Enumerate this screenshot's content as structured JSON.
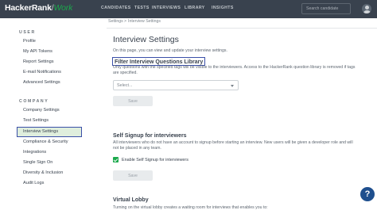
{
  "header": {
    "brand": "HackerRank",
    "brand_suffix": "Work",
    "nav": [
      "CANDIDATES",
      "TESTS",
      "INTERVIEWS",
      "LIBRARY",
      "INSIGHTS"
    ],
    "search_placeholder": "Search candidate"
  },
  "sidebar": {
    "user_heading": "USER",
    "user_items": [
      "Profile",
      "My API Tokens",
      "Report Settings",
      "E-mail Notifications",
      "Advanced Settings"
    ],
    "company_heading": "COMPANY",
    "company_items": [
      "Company Settings",
      "Test Settings",
      "Interview Settings",
      "Compliance & Security",
      "Integrations",
      "Single Sign On",
      "Diversity & Inclusion",
      "Audit Logs"
    ],
    "active_item": "Interview Settings"
  },
  "breadcrumb": {
    "root": "Settings",
    "separator": ">",
    "current": "Interview Settings"
  },
  "main": {
    "title": "Interview Settings",
    "subtitle": "On this page, you can view and update your interview settings.",
    "filter": {
      "heading": "Filter Interview Questions Library",
      "description": "Only questions with the specified tags will be visible to the interviewers. Access to the HackerRank question library is removed if tags are specified.",
      "select_placeholder": "Select...",
      "save_label": "Save"
    },
    "self_signup": {
      "heading": "Self Signup for interviewers",
      "description": "All interviewers who do not have an account to signup before starting an interview. New users will be given a developer role and will not be placed in any team.",
      "checkbox_label": "Enable Self Signup for interviewers",
      "checked": true,
      "save_label": "Save"
    },
    "virtual_lobby": {
      "heading": "Virtual Lobby",
      "description": "Turning on the virtual lobby creates a waiting room for interviews that enables you to:"
    }
  },
  "help_button": "?",
  "colors": {
    "topbar": "#39424e",
    "accent_green": "#1ba94c",
    "highlight_border": "#3a4fa8",
    "active_bg": "#dfeedd",
    "help_button": "#1f4f8e"
  }
}
